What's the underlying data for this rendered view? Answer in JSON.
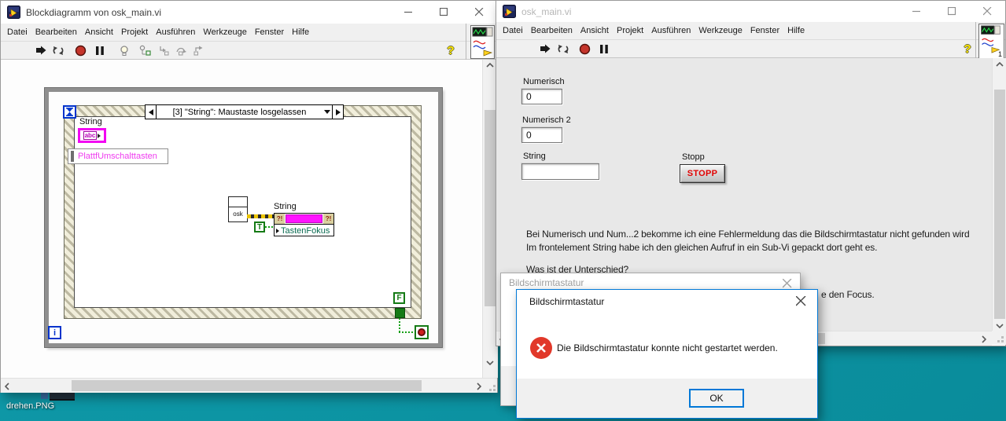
{
  "desktop": {
    "icon_label": "drehen.PNG"
  },
  "chrome": {
    "help_glyph": "?"
  },
  "menu": [
    "Datei",
    "Bearbeiten",
    "Ansicht",
    "Projekt",
    "Ausführen",
    "Werkzeuge",
    "Fenster",
    "Hilfe"
  ],
  "block_diagram_window": {
    "title": "Blockdiagramm von osk_main.vi",
    "diagram": {
      "event_case": "[3] \"String\": Maustaste losgelassen",
      "string_label": "String",
      "string_terminal_glyph": "abc",
      "local_variable": "PlattfUmschalttasten",
      "subvi_label": "osk",
      "property_node_class": "String",
      "property_node_badge": "?!",
      "property_node_property": "TastenFokus",
      "true_constant": "T",
      "false_constant": "F",
      "iteration_terminal": "i"
    }
  },
  "front_panel_window": {
    "title": "osk_main.vi",
    "logo_badge": "1",
    "controls": {
      "numeric1_label": "Numerisch",
      "numeric1_value": "0",
      "numeric2_label": "Numerisch 2",
      "numeric2_value": "0",
      "string_label": "String",
      "string_value": "",
      "stop_label": "Stopp",
      "stop_button": "STOPP"
    },
    "note_line1": "Bei Numerisch und Num...2 bekomme ich eine Fehlermeldung das die Bildschirmtastatur nicht gefunden wird",
    "note_line2": "Im frontelement String habe ich den gleichen Aufruf in ein Sub-Vi gepackt dort geht es.",
    "note_line3": "Was ist der Unterschied?",
    "note_fragment": "e den Focus."
  },
  "background_dialog": {
    "title": "Bildschirmtastatur"
  },
  "error_dialog": {
    "title": "Bildschirmtastatur",
    "message": "Die Bildschirmtastatur konnte nicht gestartet werden.",
    "ok_label": "OK"
  },
  "colors": {
    "desktop_teal": "#0D95A4",
    "accent_blue": "#0078D7",
    "labview_magenta": "#F207F2",
    "labview_green": "#157A15",
    "abort_red": "#C5352C",
    "error_red": "#E1382A",
    "stop_text_red": "#E00000"
  }
}
